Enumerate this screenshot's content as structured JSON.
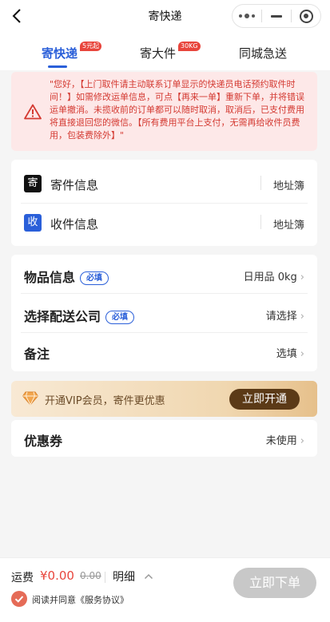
{
  "navbar": {
    "title": "寄快递"
  },
  "tabs": [
    {
      "label": "寄快递",
      "badge": "5元起"
    },
    {
      "label": "寄大件",
      "badge": "30KG"
    },
    {
      "label": "同城急送"
    }
  ],
  "notice": {
    "text": "\"您好，【上门取件请主动联系订单显示的快递员电话预约取件时间！】如需修改运单信息，可点【再来一单】重新下单，并将错误运单撤消。未揽收前的订单都可以随时取消，取消后，已支付费用将直接退回您的微信。【所有费用平台上支付，无需再给收件员费用，包装费除外】\""
  },
  "address": {
    "sender": {
      "tag": "寄",
      "label": "寄件信息",
      "book": "地址簿",
      "tag_color": "#111111"
    },
    "receiver": {
      "tag": "收",
      "label": "收件信息",
      "book": "地址簿",
      "tag_color": "#2a5fd9"
    }
  },
  "details": {
    "item": {
      "label": "物品信息",
      "required": "必填",
      "value": "日用品 0kg"
    },
    "company": {
      "label": "选择配送公司",
      "required": "必填",
      "value": "请选择"
    },
    "remark": {
      "label": "备注",
      "value": "选填"
    }
  },
  "vip": {
    "text": "开通VIP会员，寄件更优惠",
    "button": "立即开通"
  },
  "coupon": {
    "label": "优惠券",
    "value": "未使用"
  },
  "footer": {
    "fee_label": "运费",
    "fee_amount": "¥0.00",
    "fee_original": "0.00",
    "detail": "明细",
    "agree_text": "阅读并同意《服务协议》",
    "submit": "立即下单"
  },
  "colors": {
    "accent": "#2a5fd9",
    "warning": "#d43a32",
    "price": "#e8453c",
    "vip_button": "#5b3a17",
    "submit_disabled": "#c8c8c8"
  }
}
